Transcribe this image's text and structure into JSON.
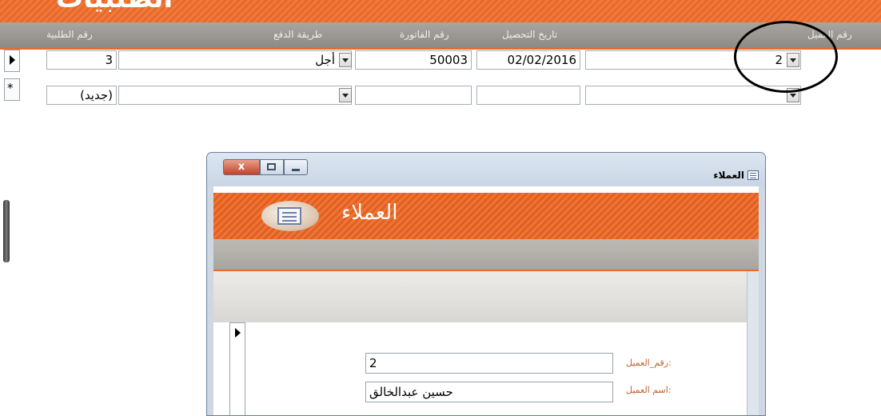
{
  "banner": {
    "title": "الطلبيات"
  },
  "columns": {
    "customer_no": "رقم العميل",
    "collection_date": "تاريخ التحصيل",
    "invoice_no": "رقم الفاتورة",
    "payment_method": "طريقة الدفع",
    "order_no": "رقم الطلبية"
  },
  "rows": [
    {
      "customer_no": "2",
      "collection_date": "02/02/2016",
      "invoice_no": "50003",
      "payment_method": "أجل",
      "order_no": "3"
    },
    {
      "customer_no": "",
      "collection_date": "",
      "invoice_no": "",
      "payment_method": "",
      "order_no": "(جديد)"
    }
  ],
  "new_record_marker": "*",
  "dialog": {
    "title": "العملاء",
    "header_title": "العملاء",
    "close_label": "x",
    "fields": [
      {
        "label": "رقم_العميل:",
        "value": "2"
      },
      {
        "label": "اسم العميل:",
        "value": "حسين عبدالخالق"
      }
    ]
  }
}
